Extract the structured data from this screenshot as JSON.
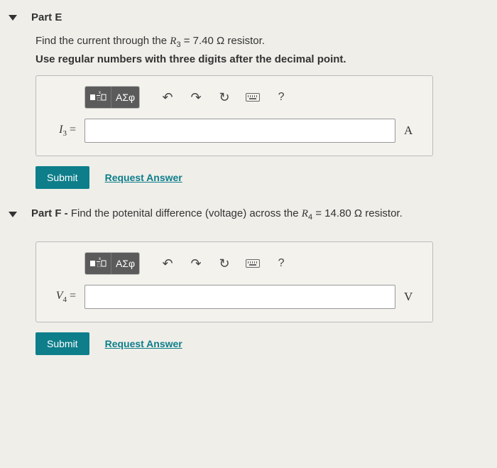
{
  "partE": {
    "label": "Part E",
    "prompt_pre": "Find the current through the ",
    "prompt_var_html": "R",
    "prompt_var_sub": "3",
    "prompt_mid": " = 7.40 Ω resistor.",
    "instruction": "Use regular numbers with three digits after the decimal point.",
    "lhs_var": "I",
    "lhs_sub": "3",
    "lhs_eq": " =",
    "unit": "A",
    "toolbar": {
      "greek": "ΑΣφ",
      "undo": "↶",
      "redo": "↷",
      "reset": "↻",
      "help": "?"
    },
    "submit": "Submit",
    "request": "Request Answer"
  },
  "partF": {
    "label_strong": "Part F - ",
    "label_rest_pre": "Find the potenital difference (voltage) across the ",
    "label_var": "R",
    "label_var_sub": "4",
    "label_rest_post": " = 14.80 Ω resistor.",
    "lhs_var": "V",
    "lhs_sub": "4",
    "lhs_eq": " =",
    "unit": "V",
    "toolbar": {
      "greek": "ΑΣφ",
      "undo": "↶",
      "redo": "↷",
      "reset": "↻",
      "help": "?"
    },
    "submit": "Submit",
    "request": "Request Answer"
  }
}
